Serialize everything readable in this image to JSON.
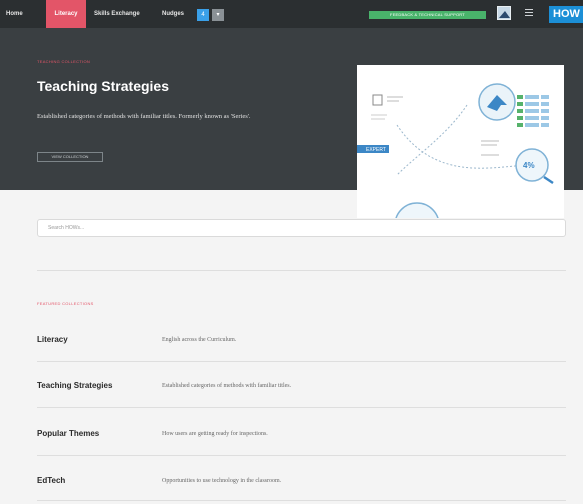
{
  "nav": {
    "items": [
      "Home",
      "Literacy",
      "Skills Exchange",
      "Nudges"
    ],
    "square_blue": "4",
    "feedback_label": "FEEDBACK & TECHNICAL SUPPORT",
    "logo_text": "HOW"
  },
  "hero": {
    "eyebrow": "TEACHING COLLECTION",
    "title": "Teaching Strategies",
    "description": "Established categories of methods with familiar titles. Formerly known as 'Series'.",
    "button_label": "VIEW COLLECTION",
    "figure": {
      "tag_label": "EXPERT",
      "percent_label": "4%"
    }
  },
  "search": {
    "placeholder": "Search HOWs..."
  },
  "collections": {
    "label": "FEATURED COLLECTIONS",
    "rows": [
      {
        "name": "Literacy",
        "description": "English across the Curriculum."
      },
      {
        "name": "Teaching Strategies",
        "description": "Established categories of methods with familiar titles."
      },
      {
        "name": "Popular Themes",
        "description": "How users are getting ready for inspections."
      },
      {
        "name": "EdTech",
        "description": "Opportunities to use technology in the classroom."
      }
    ]
  },
  "colors": {
    "accent": "#e35568",
    "brand": "#1c8fd6",
    "success": "#49b36b",
    "nav_bg": "#2b2f31",
    "hero_bg": "#3a3f42"
  }
}
